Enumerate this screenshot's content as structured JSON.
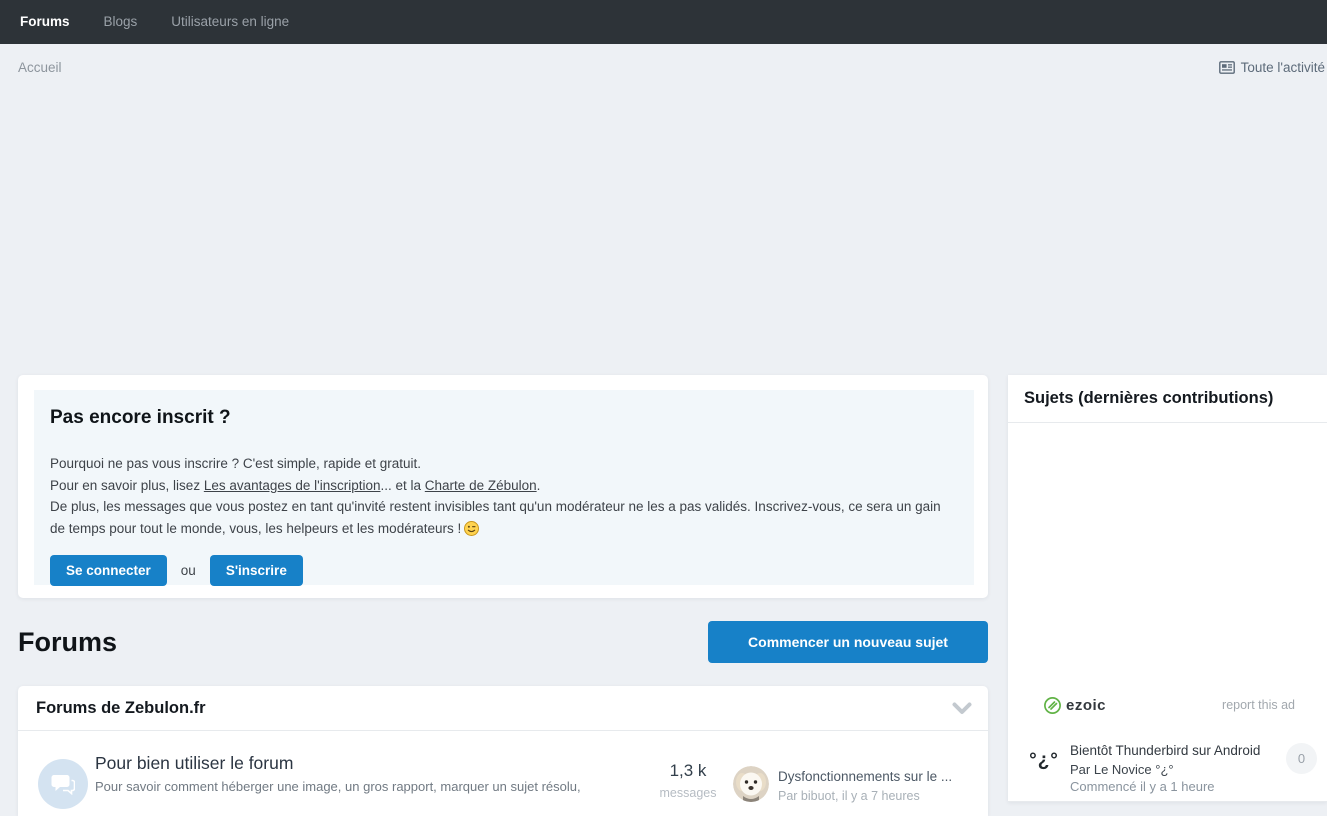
{
  "colors": {
    "accent_blue": "#1781c8",
    "navbar_bg": "#2d3338",
    "page_bg": "#edf0f4",
    "signup_box_bg": "#f2f7fa",
    "ezoic_green": "#61b346"
  },
  "navbar": {
    "items": [
      {
        "label": "Forums",
        "active": true
      },
      {
        "label": "Blogs",
        "active": false
      },
      {
        "label": "Utilisateurs en ligne",
        "active": false
      }
    ]
  },
  "breadcrumb": {
    "home": "Accueil",
    "all_activity": "Toute l'activité"
  },
  "signup_card": {
    "title": "Pas encore inscrit ?",
    "line1": "Pourquoi ne pas vous inscrire ? C'est simple, rapide et gratuit.",
    "line2_prefix": "Pour en savoir plus, lisez ",
    "line2_link1": "Les avantages de l'inscription",
    "line2_mid": "... et la ",
    "line2_link2": "Charte de Zébulon",
    "line2_suffix": ".",
    "line3": "De plus, les messages que vous postez en tant qu'invité restent invisibles tant qu'un modérateur ne les a pas validés. Inscrivez-vous, ce sera un gain de temps pour tout le monde, vous, les helpeurs et les modérateurs !",
    "login_button": "Se connecter",
    "or_text": "ou",
    "register_button": "S'inscrire"
  },
  "forums_section": {
    "heading": "Forums",
    "new_topic_button": "Commencer un nouveau sujet"
  },
  "forum_panel": {
    "title": "Forums de Zebulon.fr",
    "row": {
      "title": "Pour bien utiliser le forum",
      "description": "Pour savoir comment héberger une image, un gros rapport, marquer un sujet résolu,",
      "stat_value": "1,3 k",
      "stat_label": "messages",
      "last_post_title": "Dysfonctionnements sur le ...",
      "last_post_byline": "Par bibuot, il y a 7 heures"
    }
  },
  "sidebar": {
    "title": "Sujets (dernières contributions)",
    "ad": {
      "brand": "ezoic",
      "report_label": "report this ad"
    },
    "topic": {
      "avatar_text": "°¿°",
      "title": "Bientôt Thunderbird sur Android",
      "byline": "Par Le Novice °¿°",
      "started": "Commencé il y a 1 heure",
      "replies": "0"
    }
  }
}
